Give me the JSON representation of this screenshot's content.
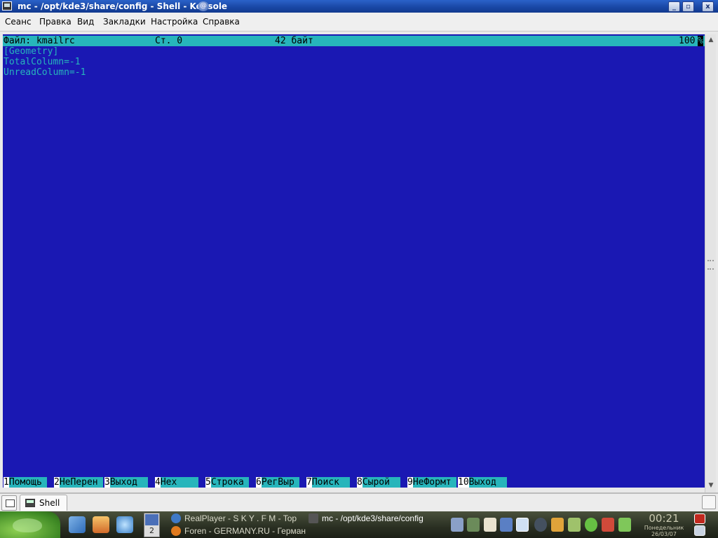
{
  "window": {
    "title": "mc - /opt/kde3/share/config - Shell - Konsole",
    "sticky_icon": "sticky-swirl-icon",
    "buttons": [
      "minimize",
      "maximize",
      "close"
    ],
    "minimize_glyph": "_",
    "maximize_glyph": "▫",
    "close_glyph": "x"
  },
  "menu": [
    "Сеанс",
    "Правка",
    "Вид",
    "Закладки",
    "Настройка",
    "Справка"
  ],
  "terminal": {
    "status": {
      "file": "Файл: kmailrc",
      "line": "Ст. 0",
      "size": "42 байт",
      "percent": "100",
      "percent_mark": "%"
    },
    "lines": [
      "[Geometry]",
      "TotalColumn=-1",
      "UnreadColumn=-1"
    ],
    "fkeys": [
      {
        "num": "1",
        "label": "Помощь"
      },
      {
        "num": "2",
        "label": "НеПерен"
      },
      {
        "num": "3",
        "label": "Выход"
      },
      {
        "num": "4",
        "label": "Hex"
      },
      {
        "num": "5",
        "label": "Строка"
      },
      {
        "num": "6",
        "label": "РегВыр"
      },
      {
        "num": "7",
        "label": "Поиск"
      },
      {
        "num": "8",
        "label": "Сырой"
      },
      {
        "num": "9",
        "label": "НеФормт"
      },
      {
        "num": "10",
        "label": "Выход"
      }
    ],
    "colors": {
      "background": "#1a18b3",
      "text": "#27b5bb",
      "bar": "#27b5bb"
    }
  },
  "tabs": {
    "new_tab_icon": "new-session-icon",
    "items": [
      {
        "label": "Shell",
        "icon": "terminal-icon"
      }
    ],
    "close_icon": "close-session-icon"
  },
  "taskbar": {
    "quick_launch": [
      "desktop-icon",
      "home-icon",
      "kde-control-icon"
    ],
    "pager": {
      "current": "2"
    },
    "tasks": [
      {
        "label": "RealPlayer - S K Y . F M - Top",
        "icon": "realplayer-icon",
        "active": false
      },
      {
        "label": "mc - /opt/kde3/share/config",
        "icon": "konsole-icon",
        "active": true
      },
      {
        "label": "Foren - GERMANY.RU - Герман",
        "icon": "firefox-icon",
        "active": false
      }
    ],
    "tray": [
      "volume-icon",
      "mixer-icon",
      "klipper-icon",
      "network-icon",
      "network-manager-icon",
      "bluetooth-icon",
      "sim-icon",
      "battery-icon",
      "leaf-icon",
      "updater-icon",
      "gecko-icon"
    ],
    "clock": {
      "time": "00:21",
      "weekday": "Понедельник",
      "date": "26/03/07"
    },
    "logout_icon": "logout-icon",
    "lock_icon": "lock-icon"
  }
}
